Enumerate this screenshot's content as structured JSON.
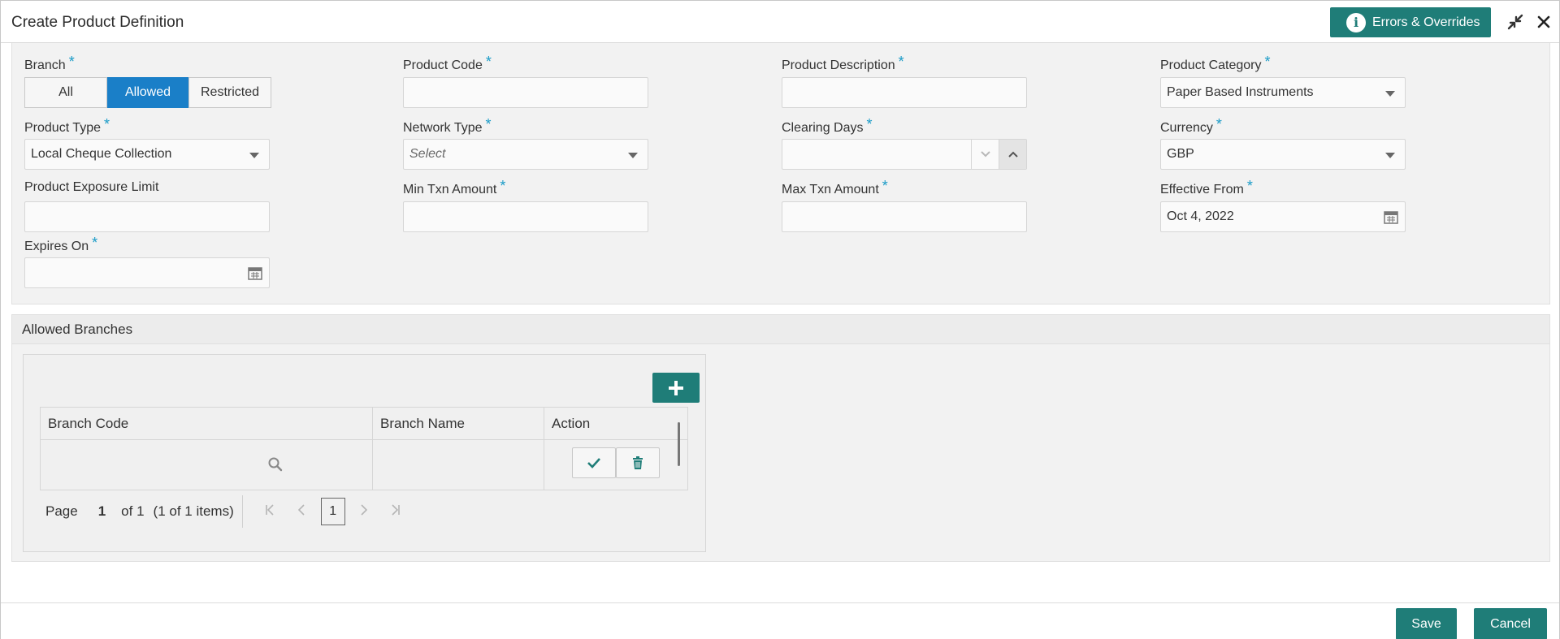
{
  "header": {
    "title": "Create Product Definition",
    "errors_label": "Errors & Overrides",
    "info_glyph": "i"
  },
  "form": {
    "branch": {
      "label": "Branch",
      "options": [
        "All",
        "Allowed",
        "Restricted"
      ],
      "selected": "Allowed"
    },
    "product_code": {
      "label": "Product Code",
      "value": ""
    },
    "product_description": {
      "label": "Product Description",
      "value": ""
    },
    "product_category": {
      "label": "Product Category",
      "value": "Paper Based Instruments"
    },
    "product_type": {
      "label": "Product Type",
      "value": "Local Cheque Collection"
    },
    "network_type": {
      "label": "Network Type",
      "placeholder": "Select"
    },
    "clearing_days": {
      "label": "Clearing Days",
      "value": ""
    },
    "currency": {
      "label": "Currency",
      "value": "GBP"
    },
    "product_exposure_limit": {
      "label": "Product Exposure Limit",
      "value": ""
    },
    "min_txn_amount": {
      "label": "Min Txn Amount",
      "value": ""
    },
    "max_txn_amount": {
      "label": "Max Txn Amount",
      "value": ""
    },
    "effective_from": {
      "label": "Effective From",
      "value": "Oct 4, 2022"
    },
    "expires_on": {
      "label": "Expires On",
      "value": ""
    },
    "required_mark": "*"
  },
  "allowed_branches": {
    "title": "Allowed Branches",
    "columns": [
      "Branch Code",
      "Branch Name",
      "Action"
    ],
    "pagination": {
      "page_label": "Page",
      "page": "1",
      "of_label": "of 1",
      "items_label": "(1 of 1 items)",
      "current": "1"
    }
  },
  "footer": {
    "save_label": "Save",
    "cancel_label": "Cancel"
  },
  "colors": {
    "accent": "#1f7d78",
    "selected_segment": "#1a7fc8",
    "required": "#1a9bc7"
  }
}
